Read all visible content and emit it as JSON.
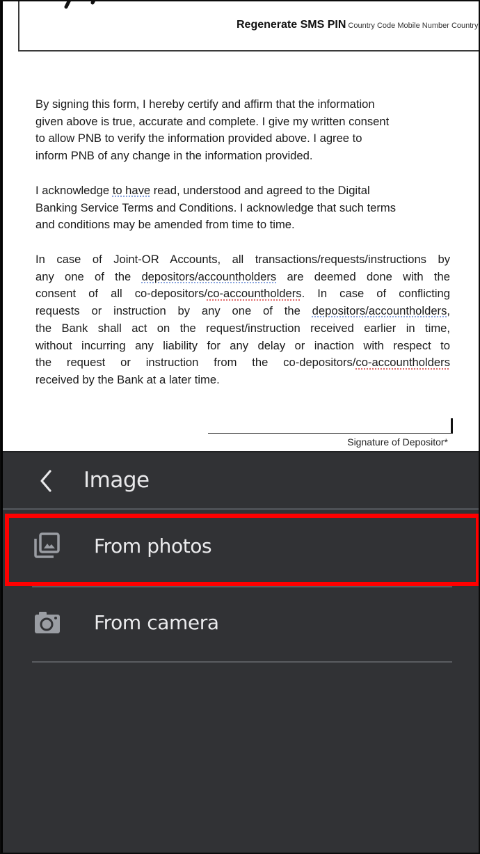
{
  "document": {
    "box_caption_bold": "Regenerate SMS PIN",
    "box_caption_small": "Country Code Mobile Number Country",
    "paragraph1": "By signing this form, I hereby certify and affirm that the information given above is true, accurate and complete. I give my written  consent to allow PNB to verify the information provided above. I agree to inform PNB of any change in the information provided.",
    "paragraph1_lines": [
      "By signing this form, I hereby certify and affirm that the information",
      "given above is true, accurate and complete. I give my written  consent",
      "to allow PNB to verify the information provided above. I agree to",
      "inform PNB of any change in the information provided."
    ],
    "paragraph2_lines": [
      {
        "pre": "I acknowledge ",
        "underlined": "to have",
        "post": " read, understood and agreed to the Digital"
      },
      "Banking Service Terms and Conditions. I acknowledge that such  terms",
      "and conditions may be amended from time to time."
    ],
    "paragraph3_lines": [
      "In case of Joint-OR Accounts, all transactions/requests/instructions by",
      {
        "pre": "any one of the ",
        "underlined": "depositors/accountholders",
        "post": " are deemed done  with the"
      },
      {
        "pre": "consent of all co-depositors/",
        "underlined_red": "co-accountholders",
        "post": ". In case of conflicting"
      },
      {
        "pre": "requests or instruction by any one of the  ",
        "underlined": "depositors/accountholders",
        "post": ","
      },
      "the Bank shall act on the request/instruction received earlier in time,",
      "without incurring any liability for  any delay or inaction with respect to",
      {
        "pre": "the request or instruction from the co-depositors/",
        "underlined_red": "co-accountholders",
        "post": ""
      },
      "received by the Bank at a  later time."
    ],
    "signature_label": "Signature of Depositor*"
  },
  "sheet": {
    "title": "Image",
    "back_icon": "chevron-left-icon",
    "items": [
      {
        "label": "From photos",
        "icon": "photo-library-icon",
        "highlighted": true
      },
      {
        "label": "From camera",
        "icon": "camera-icon",
        "highlighted": false
      }
    ]
  },
  "colors": {
    "sheet_bg": "#313235",
    "highlight": "#ff0000",
    "icon": "#9a9da3",
    "text_light": "#ececee"
  }
}
